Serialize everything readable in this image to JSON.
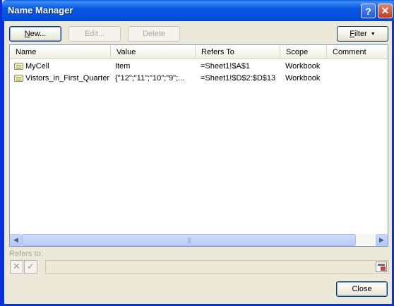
{
  "window": {
    "title": "Name Manager",
    "help_label": "?",
    "close_label": "✕"
  },
  "toolbar": {
    "new_label_underlined": "N",
    "new_label_rest": "ew...",
    "edit_label": "Edit...",
    "delete_label": "Delete",
    "filter_label_underlined": "F",
    "filter_label_rest": "ilter",
    "filter_caret": "▼"
  },
  "list": {
    "columns": [
      "Name",
      "Value",
      "Refers To",
      "Scope",
      "Comment"
    ],
    "rows": [
      {
        "name": "MyCell",
        "value": "Item",
        "refers_to": "=Sheet1!$A$1",
        "scope": "Workbook",
        "comment": ""
      },
      {
        "name": "Vistors_in_First_Quarter",
        "value": "{\"12\";\"11\";\"10\";\"9\";...",
        "refers_to": "=Sheet1!$D$2:$D$13",
        "scope": "Workbook",
        "comment": ""
      }
    ],
    "scroll_left": "◀",
    "scroll_right": "▶",
    "scroll_grip": "|||"
  },
  "refers": {
    "label": "Refers to:",
    "cancel_glyph": "✕",
    "confirm_glyph": "✓",
    "value": ""
  },
  "footer": {
    "close_label": "Close"
  },
  "colors": {
    "titlebar": "#0858e1",
    "dialog_bg": "#ece9d8",
    "button_border": "#003c74",
    "list_border": "#7f9db9"
  }
}
